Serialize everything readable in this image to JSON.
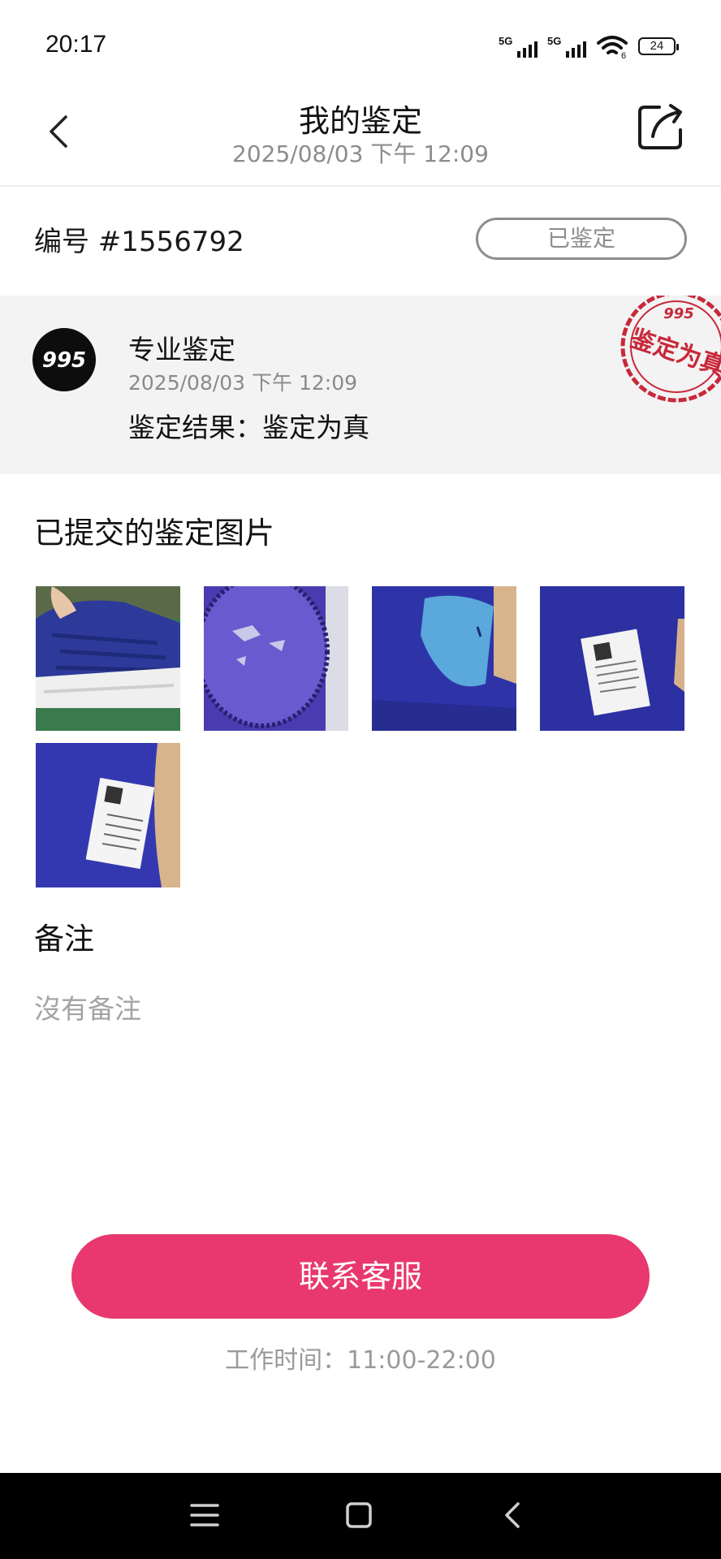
{
  "status_bar": {
    "time": "20:17",
    "network1": "5G",
    "network2": "5G",
    "battery": "24"
  },
  "header": {
    "title": "我的鉴定",
    "subtitle": "2025/08/03 下午 12:09"
  },
  "order": {
    "number": "编号 #1556792",
    "status": "已鉴定"
  },
  "result_card": {
    "service_name": "专业鉴定",
    "date": "2025/08/03 下午 12:09",
    "result_label": "鉴定结果：",
    "result_value": "鉴定为真",
    "stamp_text": "鉴定为真"
  },
  "images_section": {
    "title": "已提交的鉴定图片",
    "images": [
      {
        "name": "photo-shoe-side"
      },
      {
        "name": "photo-insole"
      },
      {
        "name": "photo-heel-pad"
      },
      {
        "name": "photo-size-tag"
      },
      {
        "name": "photo-size-tag-closeup"
      }
    ]
  },
  "remarks": {
    "title": "备注",
    "text": "沒有备注"
  },
  "contact": {
    "button_label": "联系客服",
    "work_hours": "工作时间：11:00-22:00"
  },
  "colors": {
    "accent": "#e8386f",
    "muted": "#8d8d8d",
    "card_bg": "#f3f3f3",
    "stamp": "#c8283a"
  }
}
